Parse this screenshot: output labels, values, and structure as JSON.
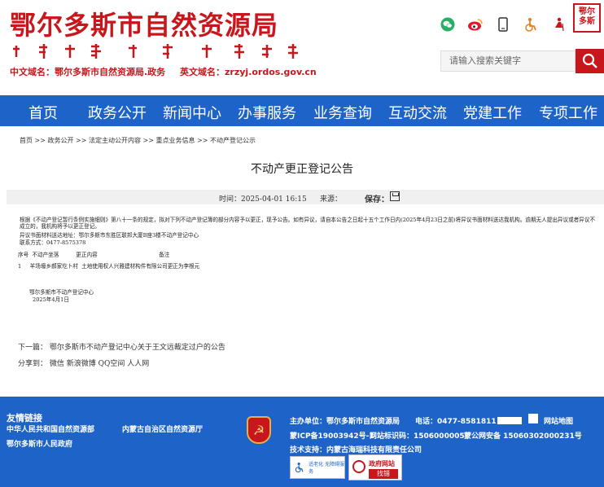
{
  "header": {
    "site_title": "鄂尔多斯市自然资源局",
    "mongolian_text": "ᠣᠷᠳᠣᠰ ᠬᠣᠲᠠ",
    "cn_domain": "中文域名：鄂尔多斯市自然资源局.政务",
    "en_domain": "英文域名：zrzyj.ordos.gov.cn",
    "seal_text_1": "鄂尔",
    "seal_text_2": "多斯",
    "icons": [
      "wechat-icon",
      "weibo-icon",
      "mobile-icon",
      "accessibility-icon",
      "elderly-icon"
    ],
    "search_placeholder": "请输入搜索关键字"
  },
  "nav": {
    "items": [
      "首页",
      "政务公开",
      "新闻中心",
      "办事服务",
      "业务查询",
      "互动交流",
      "党建工作",
      "专项工作"
    ]
  },
  "breadcrumb": "首页 >> 政务公开 >> 法定主动公开内容 >> 重点业务信息 >> 不动产登记公示",
  "article": {
    "title": "不动产更正登记公告",
    "time_label": "时间：2025-04-01 16:15",
    "source_label": "来源：",
    "save_label": "保存：",
    "para1": "根据《不动产登记暂行条例实施细则》第八十一条的规定，拟对下列不动产登记簿的部分内容予以更正，现予公告。如有异议，请自本公告之日起十五个工作日内(2025年4月23日之前)将异议书面材料送达我机构。逾期无人提出异议或者异议不成立的，我机构将予以更正登记。",
    "addr_line": "异议书面材料送达地址：鄂尔多斯市东胜区联邦大厦B座3楼不动产登记中心",
    "contact_line": "联系方式：0477-8575378",
    "table_header": "序号  不动产坐落          更正内容                                    备注",
    "table_row": "1     羊场壕乡郝家圪卜村  土地使用权人兴雅建材构件有限公司更正为李根元",
    "sign_org": "鄂尔多斯市不动产登记中心",
    "sign_date": "2025年4月1日",
    "next_article": "下一篇：  鄂尔多斯市不动产登记中心关于王文远裁定过户的公告",
    "share": "分享到：  微信  新浪微博  QQ空间  人人网"
  },
  "footer": {
    "links_heading": "友情链接",
    "links": [
      "中华人民共和国自然资源部",
      "内蒙古自治区自然资源厅",
      "鄂尔多斯市人民政府"
    ],
    "host": "主办单位：鄂尔多斯市自然资源局",
    "phone": "电话：0477-8581811",
    "sitemap": "网站地图",
    "icp": "蒙ICP备19003942号-1",
    "site_code": "网站标识码：1506000005",
    "police": "蒙公网安备 15060302000231号",
    "tech": "技术支持：内蒙古海瑞科技有限责任公司",
    "badge1": "适老化 无障碍服务",
    "badge2_top": "政府网站",
    "badge2_bottom": "找错"
  },
  "colors": {
    "brand_red": "#c8161d",
    "nav_blue": "#1e64c8"
  }
}
